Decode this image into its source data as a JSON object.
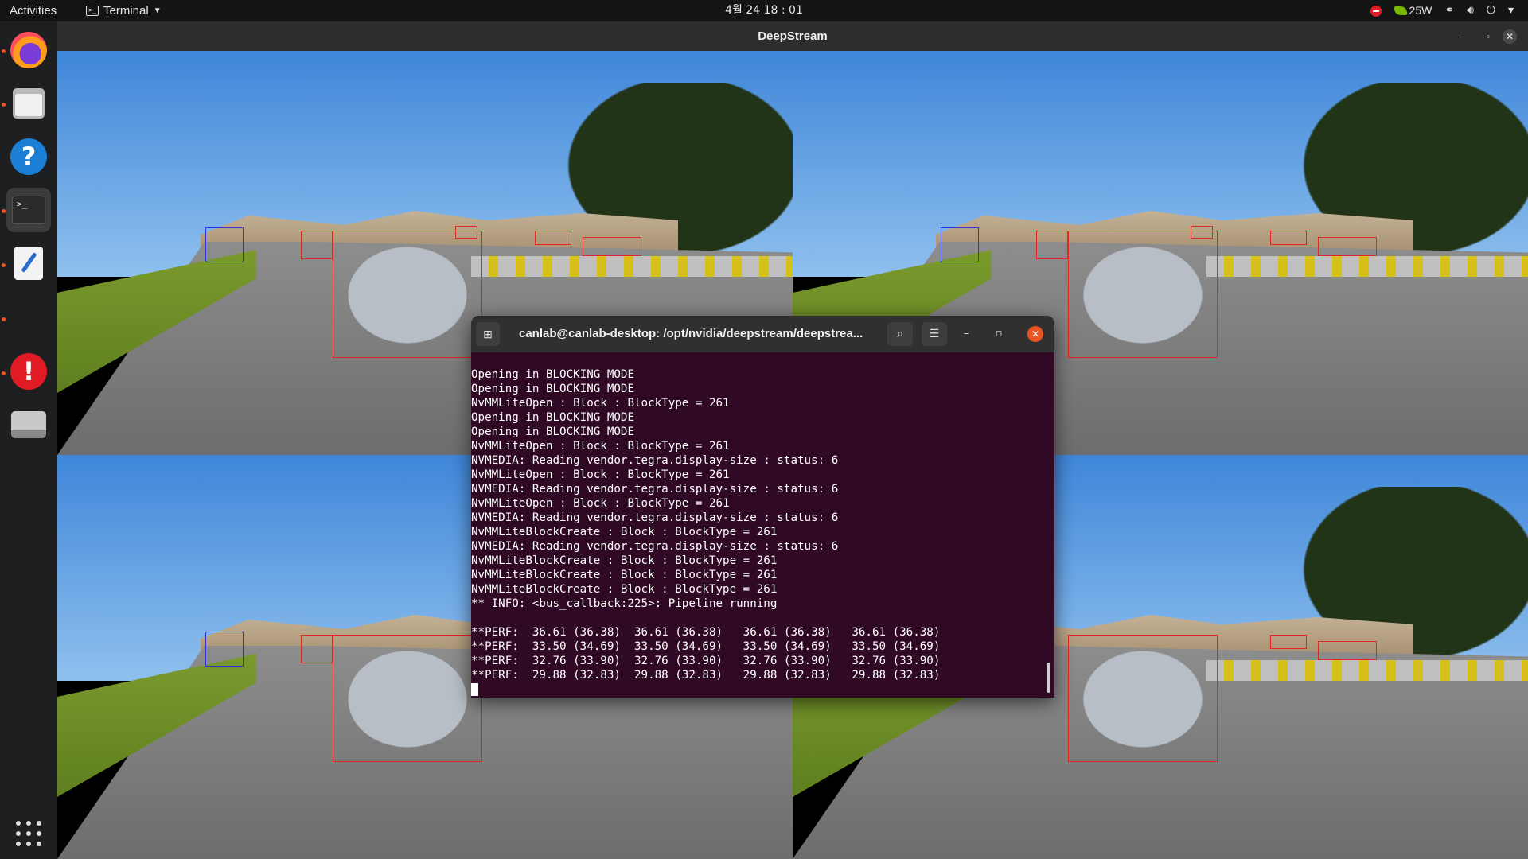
{
  "topbar": {
    "activities": "Activities",
    "app_name": "Terminal",
    "clock": "4월 24  18 : 01",
    "power_watts": "25W"
  },
  "dock": {
    "apps": [
      "Firefox",
      "Files",
      "Help",
      "Terminal",
      "Text Editor",
      "Software Updater",
      "Drive"
    ]
  },
  "deepstream": {
    "title": "DeepStream"
  },
  "terminal": {
    "title": "canlab@canlab-desktop: /opt/nvidia/deepstream/deepstrea...",
    "lines": [
      "Opening in BLOCKING MODE",
      "Opening in BLOCKING MODE",
      "NvMMLiteOpen : Block : BlockType = 261",
      "Opening in BLOCKING MODE",
      "Opening in BLOCKING MODE",
      "NvMMLiteOpen : Block : BlockType = 261",
      "NVMEDIA: Reading vendor.tegra.display-size : status: 6",
      "NvMMLiteOpen : Block : BlockType = 261",
      "NVMEDIA: Reading vendor.tegra.display-size : status: 6",
      "NvMMLiteOpen : Block : BlockType = 261",
      "NVMEDIA: Reading vendor.tegra.display-size : status: 6",
      "NvMMLiteBlockCreate : Block : BlockType = 261",
      "NVMEDIA: Reading vendor.tegra.display-size : status: 6",
      "NvMMLiteBlockCreate : Block : BlockType = 261",
      "NvMMLiteBlockCreate : Block : BlockType = 261",
      "NvMMLiteBlockCreate : Block : BlockType = 261",
      "** INFO: <bus_callback:225>: Pipeline running",
      "",
      "**PERF:  36.61 (36.38)  36.61 (36.38)   36.61 (36.38)   36.61 (36.38)",
      "**PERF:  33.50 (34.69)  33.50 (34.69)   33.50 (34.69)   33.50 (34.69)",
      "**PERF:  32.76 (33.90)  32.76 (33.90)   32.76 (33.90)   32.76 (33.90)",
      "**PERF:  29.88 (32.83)  29.88 (32.83)   29.88 (32.83)   29.88 (32.83)"
    ]
  },
  "colors": {
    "terminal_bg": "#300a24",
    "accent": "#e95420",
    "bbox_vehicle": "#e3261e",
    "bbox_person": "#2a35e0"
  }
}
